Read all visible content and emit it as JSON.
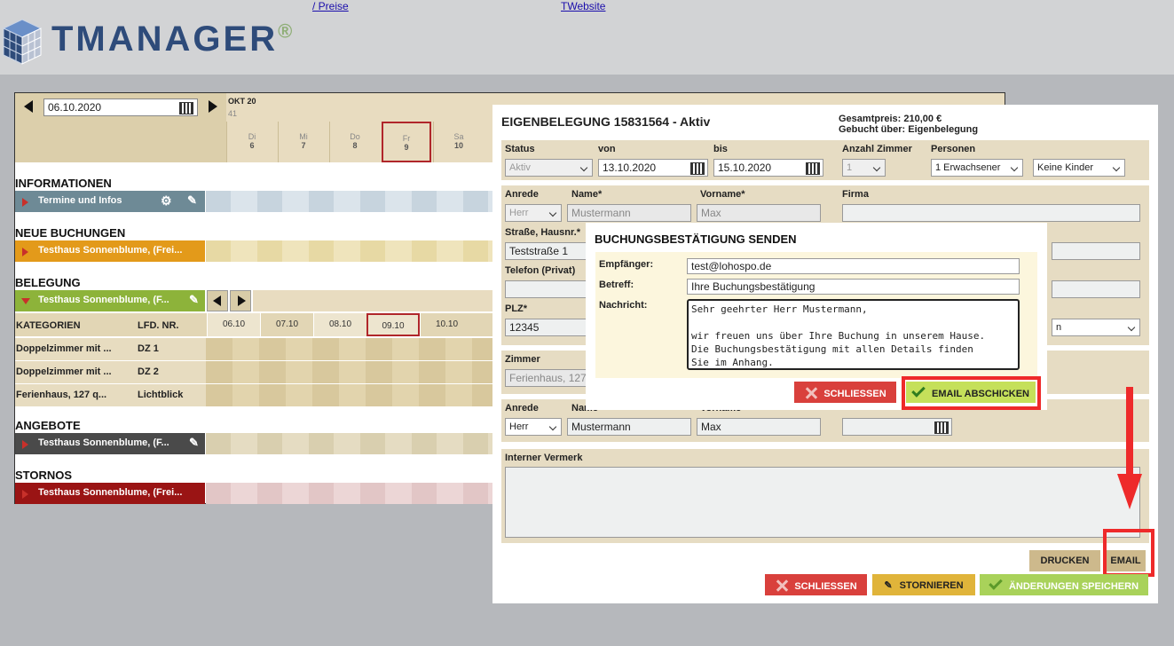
{
  "header": {
    "links": [
      "/ Preise",
      "TWebsite"
    ],
    "logo": "TMANAGER",
    "logo_mark": "®"
  },
  "calendar": {
    "date": "06.10.2020",
    "month": "OKT 20",
    "week": "41",
    "days": [
      {
        "wd": "Di",
        "d": "6"
      },
      {
        "wd": "Mi",
        "d": "7"
      },
      {
        "wd": "Do",
        "d": "8"
      },
      {
        "wd": "Fr",
        "d": "9"
      },
      {
        "wd": "Sa",
        "d": "10"
      }
    ],
    "sections": {
      "informationen": "INFORMATIONEN",
      "neue_buchungen": "NEUE BUCHUNGEN",
      "belegung": "BELEGUNG",
      "angebote": "ANGEBOTE",
      "stornos": "STORNOS"
    },
    "rows": {
      "termine": "Termine und Infos",
      "neue": "Testhaus Sonnenblume, (Frei...",
      "belegung": "Testhaus Sonnenblume, (F...",
      "angebote": "Testhaus Sonnenblume, (F...",
      "stornos": "Testhaus Sonnenblume, (Frei..."
    },
    "kategorien_label": "KATEGORIEN",
    "lfd_label": "LFD. NR.",
    "dates": [
      "06.10",
      "07.10",
      "08.10",
      "09.10",
      "10.10"
    ],
    "categories": [
      {
        "name": "Doppelzimmer mit ...",
        "nr": "DZ 1"
      },
      {
        "name": "Doppelzimmer mit ...",
        "nr": "DZ 2"
      },
      {
        "name": "Ferienhaus, 127 q...",
        "nr": "Lichtblick"
      }
    ]
  },
  "booking": {
    "title": "EIGENBELEGUNG 15831564 - Aktiv",
    "gesamtpreis_label": "Gesamtpreis:",
    "gesamtpreis": "210,00 €",
    "gebucht_label": "Gebucht über:",
    "gebucht": "Eigenbelegung",
    "status_label": "Status",
    "status": "Aktiv",
    "von_label": "von",
    "von": "13.10.2020",
    "bis_label": "bis",
    "bis": "15.10.2020",
    "zimmer_count_label": "Anzahl Zimmer",
    "zimmer_count": "1",
    "personen_label": "Personen",
    "erwachsene": "1 Erwachsener",
    "kinder": "Keine Kinder",
    "anrede_label": "Anrede",
    "anrede": "Herr",
    "name_label": "Name*",
    "name": "Mustermann",
    "vorname_label": "Vorname*",
    "vorname": "Max",
    "firma_label": "Firma",
    "strasse_label": "Straße, Hausnr.*",
    "strasse": "Teststraße 1",
    "telefon_label": "Telefon (Privat)",
    "plz_label": "PLZ*",
    "plz": "12345",
    "land_fragment": "n",
    "zimmer_label": "Zimmer",
    "zimmer": "Ferienhaus, 127",
    "anrede2_label": "Anrede",
    "name2_label": "Name",
    "vorname2_label": "Vorname",
    "anrede2": "Herr",
    "name2": "Mustermann",
    "vorname2": "Max",
    "vermerk_label": "Interner Vermerk",
    "btn_drucken": "DRUCKEN",
    "btn_email": "EMAIL",
    "btn_schliessen": "SCHLIESSEN",
    "btn_stornieren": "STORNIEREN",
    "btn_speichern": "ÄNDERUNGEN SPEICHERN"
  },
  "dialog": {
    "title": "BUCHUNGSBESTÄTIGUNG SENDEN",
    "empfaenger_label": "Empfänger:",
    "empfaenger": "test@lohospo.de",
    "betreff_label": "Betreff:",
    "betreff": "Ihre Buchungsbestätigung",
    "nachricht_label": "Nachricht:",
    "nachricht": "Sehr geehrter Herr Mustermann,\n\nwir freuen uns über Ihre Buchung in unserem Hause.\nDie Buchungsbestätigung mit allen Details finden\nSie im Anhang.",
    "btn_schliessen": "SCHLIESSEN",
    "btn_senden": "EMAIL ABSCHICKEN"
  },
  "colors": {
    "accent_green": "#c5e05a",
    "close_red": "#d9403c",
    "storno_yellow": "#e0b43a",
    "highlight_red": "#ee2a2a"
  }
}
